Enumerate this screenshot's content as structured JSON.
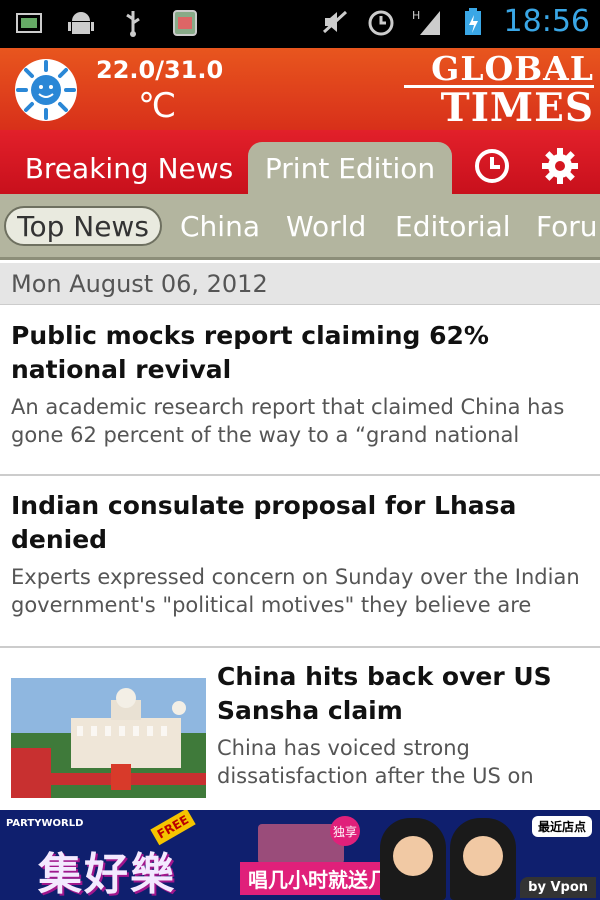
{
  "status_bar": {
    "time": "18:56",
    "icons": [
      "sd-card-icon",
      "android-icon",
      "usb-icon",
      "task-icon",
      "mute-icon",
      "alarm-icon",
      "signal-icon",
      "battery-icon"
    ]
  },
  "header": {
    "temperature": "22.0/31.0",
    "unit": "℃",
    "logo_line1": "GLOBAL",
    "logo_line2": "TIMES"
  },
  "tabs": {
    "breaking": "Breaking News",
    "print": "Print Edition",
    "active": "print"
  },
  "categories": [
    "Top News",
    "China",
    "World",
    "Editorial",
    "Foru"
  ],
  "date": "Mon August 06, 2012",
  "articles": [
    {
      "title": "Public mocks report claiming 62% national revival",
      "summary": "An academic research report that claimed China has gone 62 percent of the way to a “grand national"
    },
    {
      "title": "Indian consulate proposal for Lhasa denied",
      "summary": "Experts expressed concern on Sunday over the Indian government's \"political motives\" they believe are"
    },
    {
      "title": "China hits back over US Sansha claim",
      "summary": "China has voiced strong dissatisfaction after the US on"
    }
  ],
  "ad": {
    "brand": "PARTYWORLD",
    "title": "集好樂",
    "free_tag": "FREE",
    "exclusive": "独享",
    "slogan": "唱几小时就送几小时",
    "nearest": "最近店点",
    "by": "by Vpon"
  },
  "colors": {
    "header_orange": "#e8561e",
    "tab_red": "#d4151f",
    "category_gray": "#b3b59f",
    "clock_blue": "#3aa7e6"
  }
}
